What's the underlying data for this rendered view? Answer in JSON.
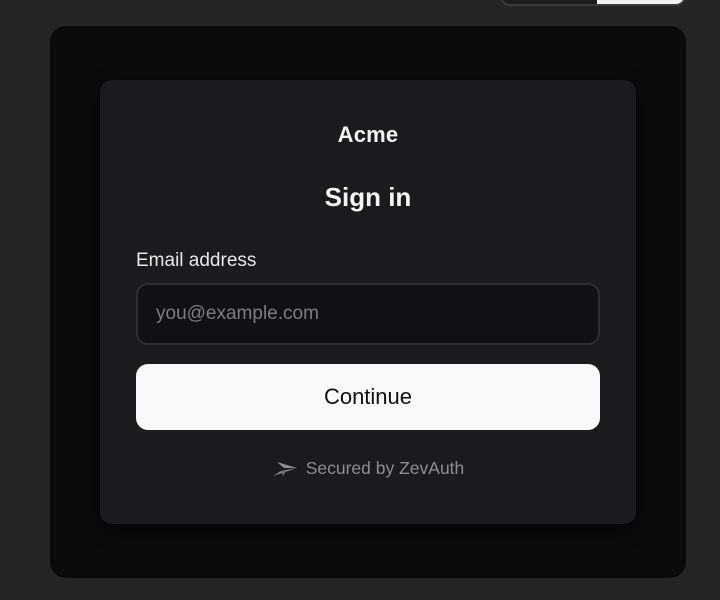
{
  "window": {
    "title": "Acme"
  },
  "form": {
    "title": "Sign in",
    "email_label": "Email address",
    "email_value": "",
    "email_placeholder": "you@example.com",
    "continue_label": "Continue"
  },
  "footer": {
    "text": "Secured by ZevAuth",
    "icon": "paper-plane-icon"
  },
  "colors": {
    "page_bg": "#242424",
    "frame_bg": "#0a0a0b",
    "card_bg": "#1b1b1d",
    "input_bg": "#111113",
    "button_bg": "#f9f9f9",
    "muted_text": "#8e8e93"
  }
}
